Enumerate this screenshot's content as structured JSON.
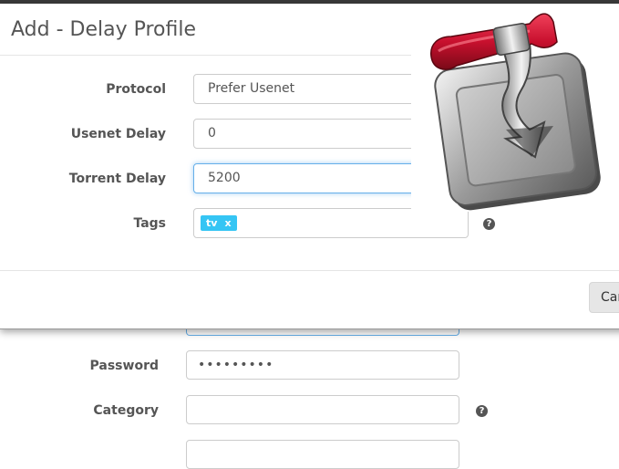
{
  "modal": {
    "title": "Add - Delay Profile",
    "fields": {
      "protocol": {
        "label": "Protocol",
        "value": "Prefer Usenet"
      },
      "usenet_delay": {
        "label": "Usenet Delay",
        "value": "0"
      },
      "torrent_delay": {
        "label": "Torrent Delay",
        "value": "5200"
      },
      "tags": {
        "label": "Tags",
        "items": [
          {
            "label": "tv",
            "remove": "x"
          }
        ]
      }
    },
    "help_glyph": "?",
    "cancel_label": "Car"
  },
  "background_form": {
    "password": {
      "label": "Password",
      "value": "•••••••••"
    },
    "category": {
      "label": "Category",
      "value": ""
    },
    "help_glyph": "?"
  },
  "logo": {
    "icon": "transmission-logo-icon"
  },
  "colors": {
    "accent": "#35c5f4",
    "focus": "#66afe9",
    "logo_red": "#c8102e"
  }
}
